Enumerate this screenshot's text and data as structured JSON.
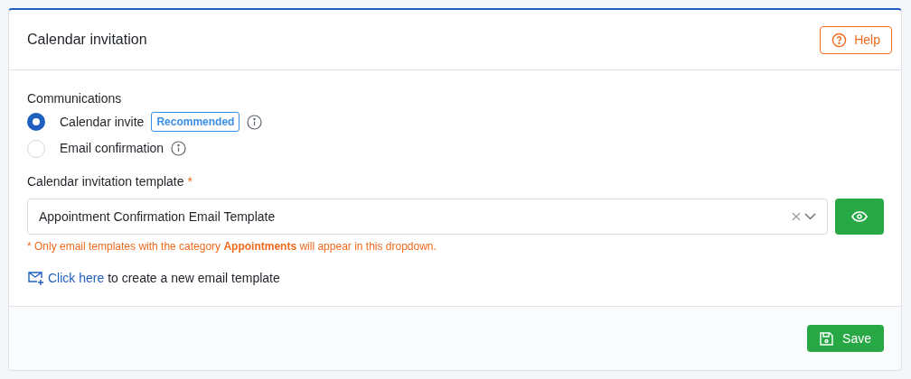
{
  "card": {
    "title": "Calendar invitation",
    "help_button": "Help"
  },
  "communications": {
    "label": "Communications",
    "options": [
      {
        "label": "Calendar invite",
        "badge": "Recommended",
        "selected": true
      },
      {
        "label": "Email confirmation",
        "selected": false
      }
    ]
  },
  "template": {
    "label": "Calendar invitation template",
    "required_mark": "*",
    "value": "Appointment Confirmation Email Template",
    "hint": "* Only email templates with the category **Appointments** will appear in this dropdown.",
    "create_link": "Click here",
    "create_text": " to create a new email template"
  },
  "footer": {
    "save_button": "Save"
  }
}
